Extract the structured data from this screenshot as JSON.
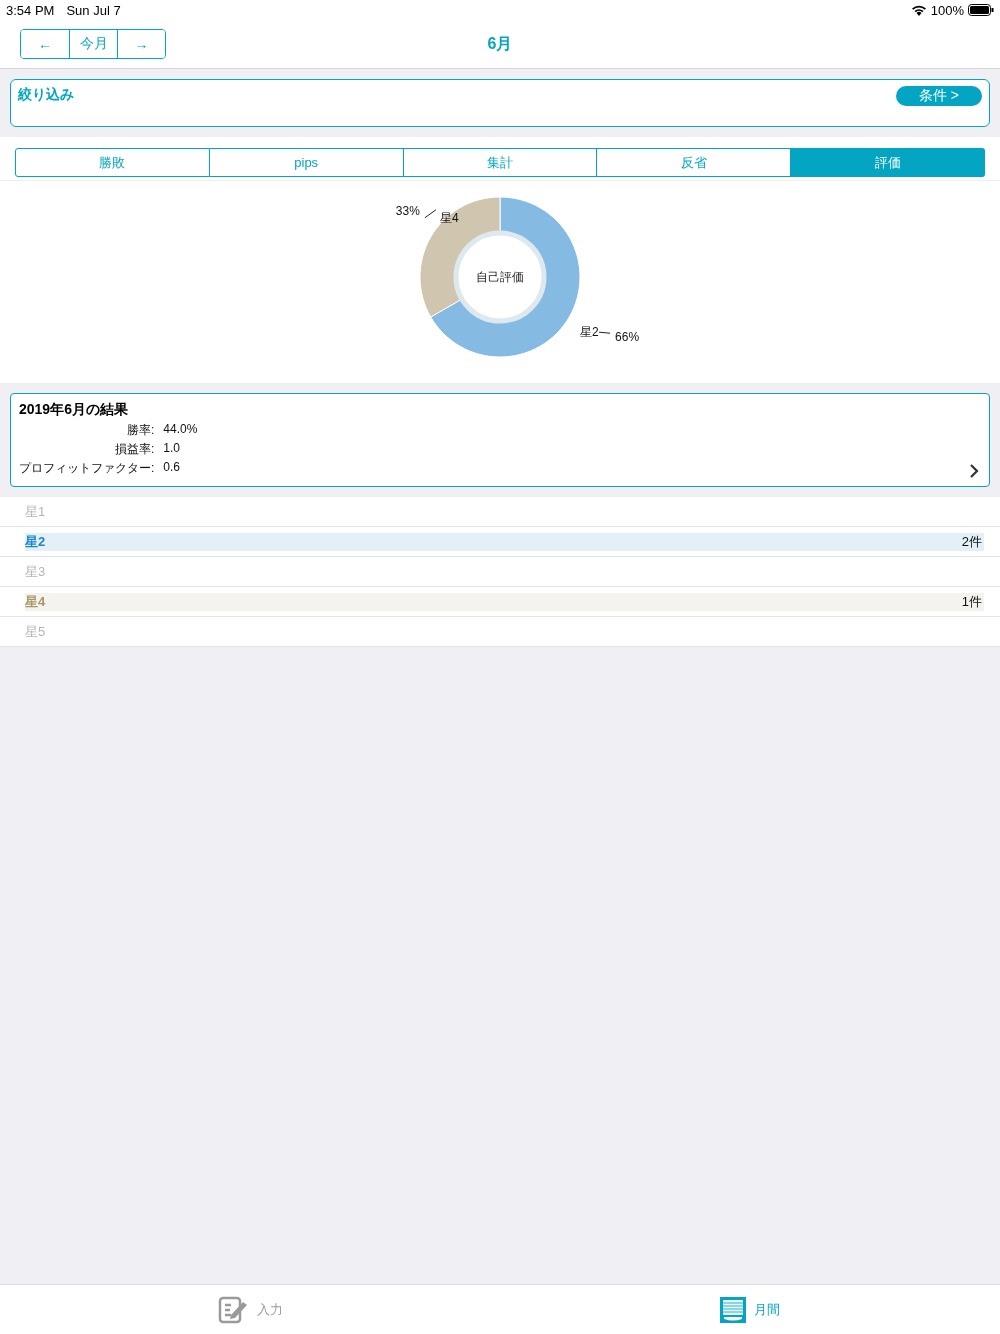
{
  "status_bar": {
    "time": "3:54 PM",
    "date": "Sun Jul 7",
    "battery": "100%"
  },
  "nav": {
    "buttons": [
      "←",
      "今月",
      "→"
    ],
    "title": "6月"
  },
  "filter": {
    "label": "絞り込み",
    "button": "条件 >"
  },
  "tabs": [
    {
      "label": "勝敗",
      "selected": false
    },
    {
      "label": "pips",
      "selected": false
    },
    {
      "label": "集計",
      "selected": false
    },
    {
      "label": "反省",
      "selected": false
    },
    {
      "label": "評価",
      "selected": true
    }
  ],
  "chart": {
    "center_label": "自己評価",
    "chart_data": {
      "type": "donut",
      "categories": [
        "星2",
        "星4"
      ],
      "values": [
        66,
        33
      ],
      "colors": [
        "#85bbe2",
        "#d0c5ae"
      ],
      "value_labels": [
        "66%",
        "33%"
      ]
    }
  },
  "summary": {
    "title": "2019年6月の結果",
    "stats": [
      {
        "label": "勝率:",
        "value": "44.0%"
      },
      {
        "label": "損益率:",
        "value": "1.0"
      },
      {
        "label": "プロフィットファクター:",
        "value": "0.6"
      }
    ]
  },
  "ratings": [
    {
      "label": "星1",
      "color": "#b4b4b4"
    },
    {
      "label": "星2",
      "count": "2件",
      "color": "#1a86c8"
    },
    {
      "label": "星3",
      "color": "#b4b4b4"
    },
    {
      "label": "星4",
      "count": "1件",
      "color": "#a8976a"
    },
    {
      "label": "星5",
      "color": "#b4b4b4"
    }
  ],
  "tab_bar": [
    {
      "label": "入力",
      "selected": false
    },
    {
      "label": "月間",
      "selected": true
    }
  ]
}
